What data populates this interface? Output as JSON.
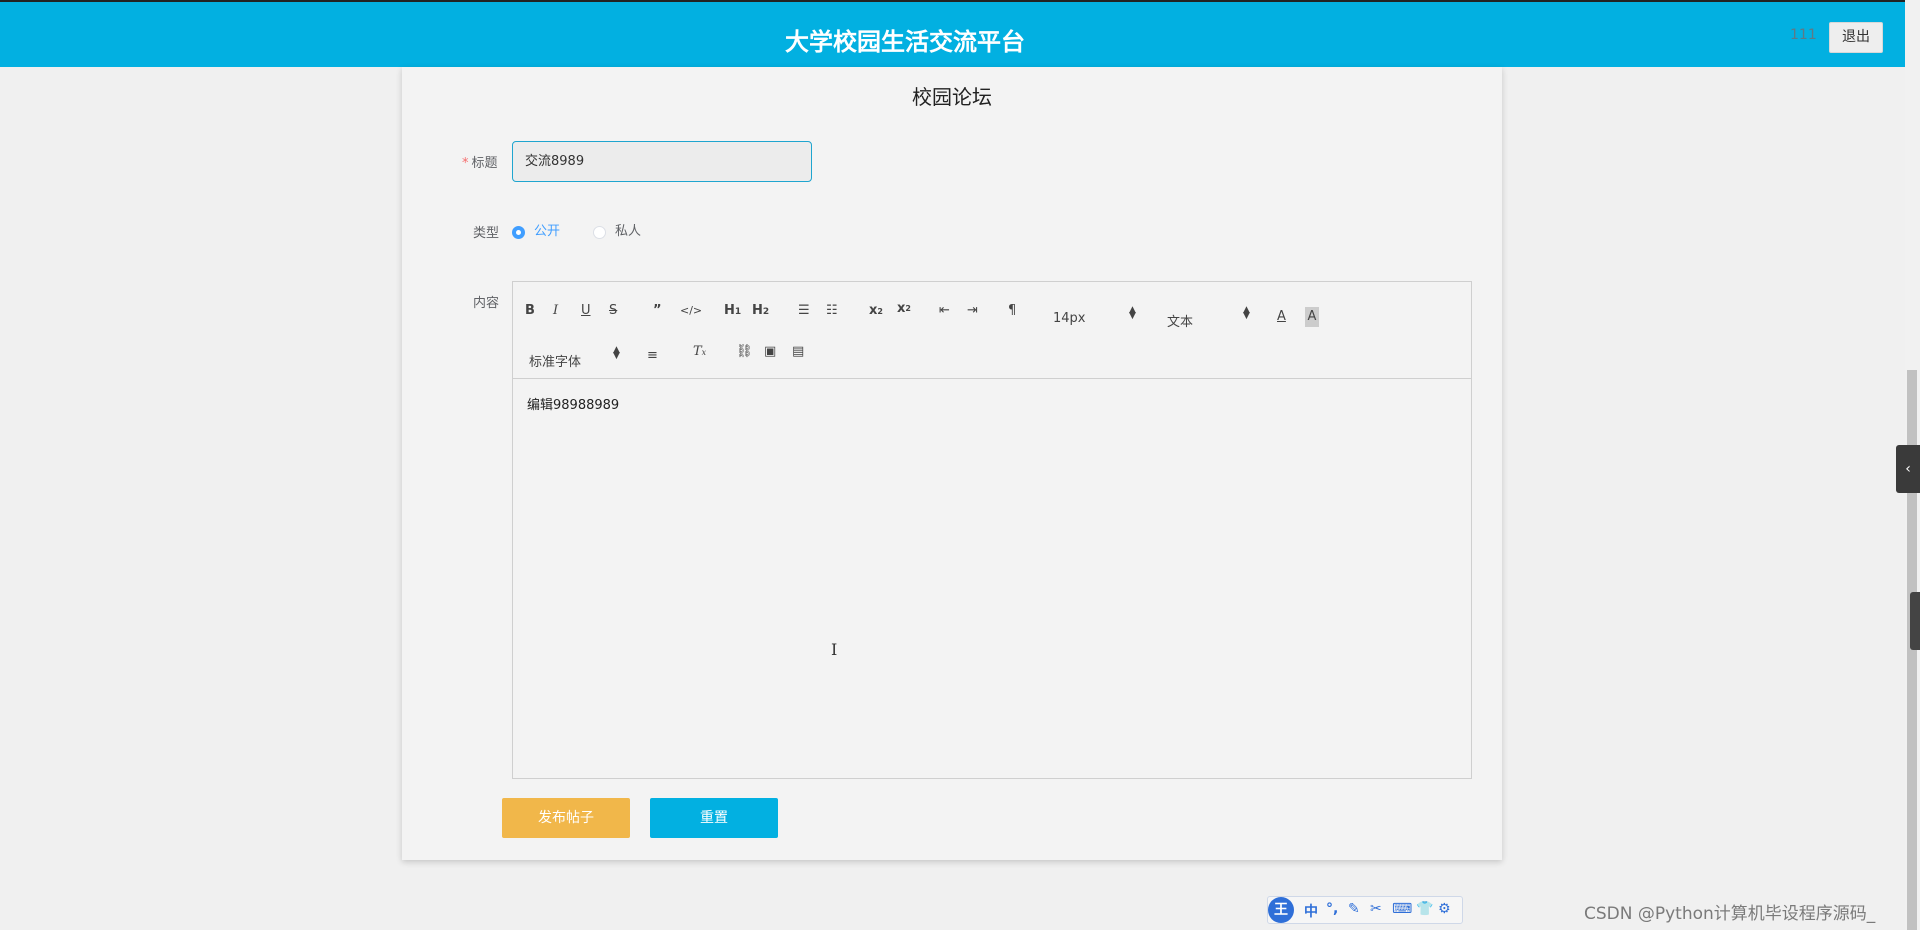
{
  "header": {
    "title": "大学校园生活交流平台",
    "user": "111",
    "logout_label": "退出"
  },
  "form": {
    "heading": "校园论坛",
    "title_label": "标题",
    "title_required_mark": "*",
    "title_value": "交流8989",
    "type_label": "类型",
    "type_options": [
      "公开",
      "私人"
    ],
    "type_selected": "公开",
    "content_label": "内容",
    "content_value": "编辑98988989",
    "publish_label": "发布帖子",
    "reset_label": "重置"
  },
  "editor_toolbar": {
    "font_size": "14px",
    "header_picker": "文本",
    "font_family": "标准字体",
    "icons": [
      "bold-icon",
      "italic-icon",
      "underline-icon",
      "strike-icon",
      "blockquote-icon",
      "code-icon",
      "h1-icon",
      "h2-icon",
      "ordered-list-icon",
      "bullet-list-icon",
      "subscript-icon",
      "superscript-icon",
      "outdent-icon",
      "indent-icon",
      "rtl-icon",
      "font-color-icon",
      "background-color-icon",
      "align-icon",
      "clean-icon",
      "link-icon",
      "image-icon",
      "video-icon"
    ]
  },
  "ime_toolbar": {
    "logo": "王",
    "mode": "中"
  },
  "watermark": "CSDN @Python计算机毕设程序源码_"
}
